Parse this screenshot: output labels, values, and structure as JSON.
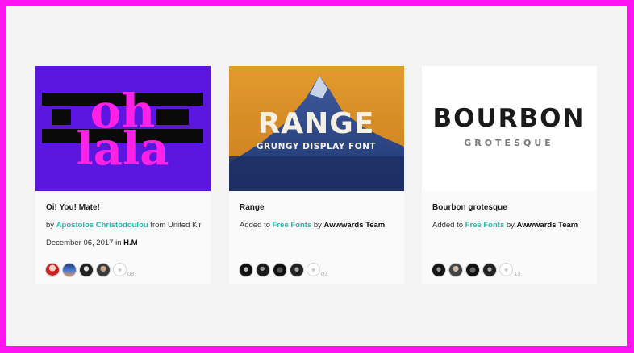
{
  "cards": [
    {
      "title": "Oi! You! Mate!",
      "by_prefix": "by ",
      "author": "Apostolos Christodoulou",
      "from_text": " from United King…",
      "date": "December 06, 2017",
      "in_text": " in ",
      "site": "H.M",
      "likes": "08",
      "thumb_text": [
        "oh",
        "lala"
      ]
    },
    {
      "title": "Range",
      "added_prefix": "Added to ",
      "collection": "Free Fonts",
      "by_text": " by ",
      "team": "Awwwards Team",
      "likes": "07",
      "thumb_text": [
        "RANGE",
        "GRUNGY DISPLAY FONT"
      ]
    },
    {
      "title": "Bourbon grotesque",
      "added_prefix": "Added to ",
      "collection": "Free Fonts",
      "by_text": " by ",
      "team": "Awwwards Team",
      "likes": "13",
      "thumb_text": [
        "BOURBON",
        "GROTESQUE"
      ]
    }
  ],
  "colors": {
    "frame": "#ff14f0",
    "background": "#f2f3f2",
    "link": "#1dbfab",
    "card1_bg": "#5b16e0",
    "card1_letters": "#ff22e6"
  },
  "icons": {
    "like": "heart-icon"
  }
}
